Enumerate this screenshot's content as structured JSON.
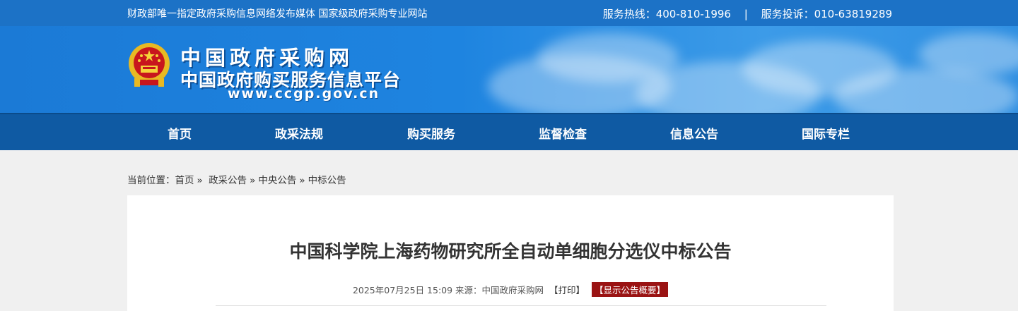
{
  "topbar": {
    "tagline": "财政部唯一指定政府采购信息网络发布媒体 国家级政府采购专业网站",
    "hotline": "服务热线：400-810-1996",
    "separator": "|",
    "complaint": "服务投诉：010-63819289"
  },
  "header": {
    "logo_icon": "national-emblem-icon",
    "site_name": "中国政府采购网",
    "site_subtitle": "中国政府购买服务信息平台",
    "site_url": "www.ccgp.gov.cn"
  },
  "nav": {
    "items": [
      {
        "label": "首页"
      },
      {
        "label": "政采法规"
      },
      {
        "label": "购买服务"
      },
      {
        "label": "监督检查"
      },
      {
        "label": "信息公告"
      },
      {
        "label": "国际专栏"
      }
    ]
  },
  "breadcrumb": {
    "prefix": "当前位置：",
    "items": [
      "首页",
      "政采公告",
      "中央公告",
      "中标公告"
    ],
    "arrow": "»"
  },
  "article": {
    "title": "中国科学院上海药物研究所全自动单细胞分选仪中标公告",
    "meta": "2025年07月25日 15:09 来源：中国政府采购网",
    "print_label": "【打印】",
    "summary_label": "【显示公告概要】"
  },
  "colors": {
    "topbar": "#1c72c6",
    "nav": "#0f5aa3",
    "summary_bg": "#9a1313"
  }
}
